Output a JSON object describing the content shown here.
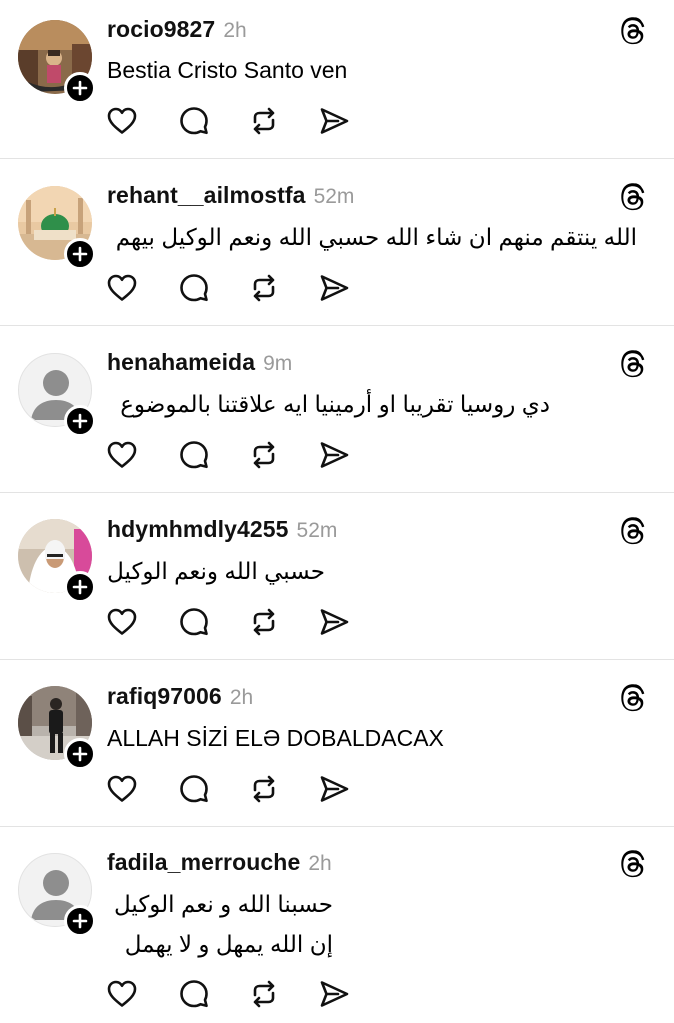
{
  "posts": [
    {
      "username": "rocio9827",
      "time": "2h",
      "lines": [
        "Bestia Cristo Santo ven"
      ],
      "avatar": "photo-gondola-icon"
    },
    {
      "username": "rehant__ailmostfa",
      "time": "52m",
      "lines": [
        "الله ينتقم منهم ان شاء الله حسبي الله ونعم الوكيل بيهم"
      ],
      "avatar": "photo-mosque-icon"
    },
    {
      "username": "henahameida",
      "time": "9m",
      "lines": [
        "دي روسيا تقريبا او أرمينيا ايه علاقتنا بالموضوع"
      ],
      "avatar": "default-avatar-icon"
    },
    {
      "username": "hdymhmdly4255",
      "time": "52m",
      "lines": [
        "حسبي الله ونعم الوكيل"
      ],
      "avatar": "photo-woman-hijab-icon"
    },
    {
      "username": "rafiq97006",
      "time": "2h",
      "lines": [
        "ALLAH SİZİ ELƏ DOBALDACAX"
      ],
      "avatar": "photo-man-street-icon"
    },
    {
      "username": "fadila_merrouche",
      "time": "2h",
      "lines": [
        "حسبنا الله و نعم الوكيل",
        "إن الله يمهل و لا يهمل"
      ],
      "avatar": "default-avatar-icon"
    }
  ],
  "icons": {
    "like": "heart-icon",
    "reply": "comment-icon",
    "repost": "repost-icon",
    "share": "send-icon",
    "brand": "threads-logo-icon",
    "follow": "plus-icon"
  },
  "colors": {
    "text": "#000000",
    "muted": "#9a9a9a",
    "divider": "#e3e3e3"
  }
}
